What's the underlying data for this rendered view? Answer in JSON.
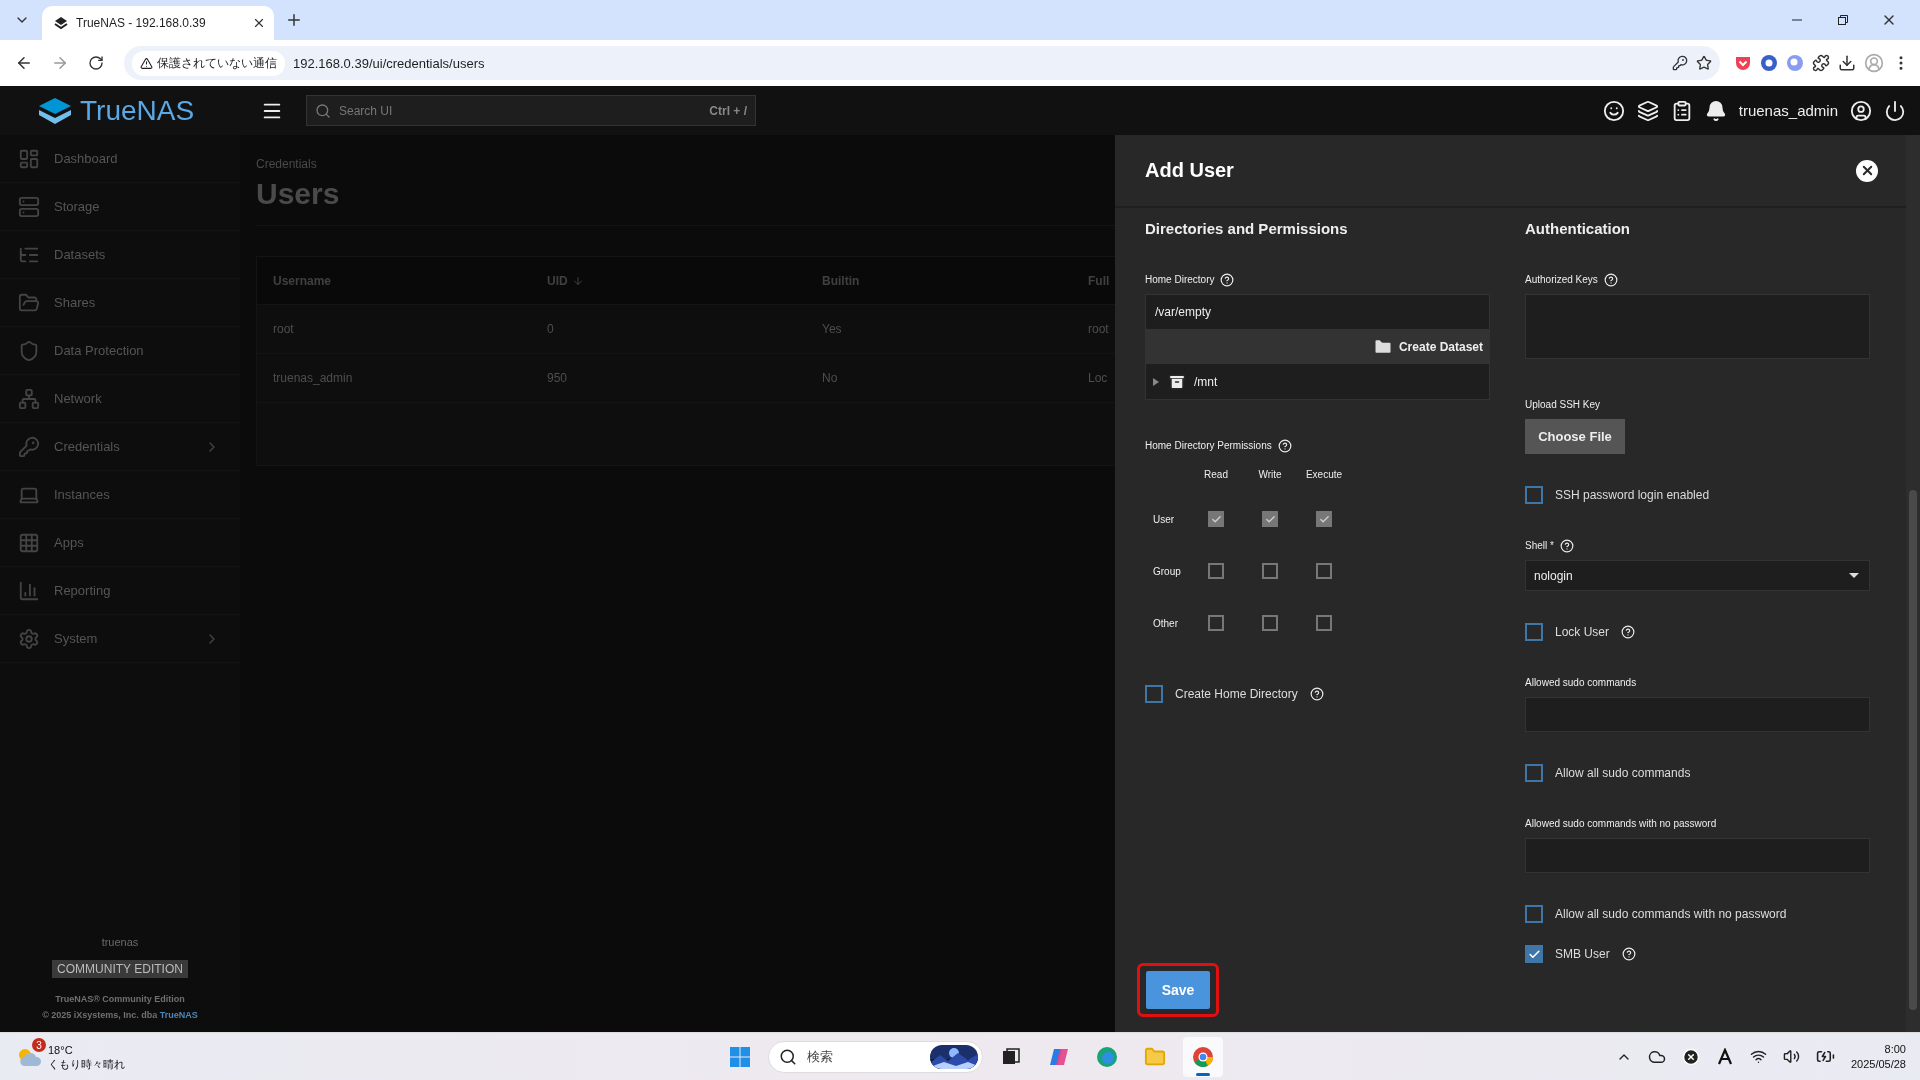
{
  "browser": {
    "tab": {
      "title": "TrueNAS - 192.168.0.39"
    },
    "security_chip": "保護されていない通信",
    "url": "192.168.0.39/ui/credentials/users"
  },
  "header": {
    "logo": "TrueNAS",
    "search": {
      "placeholder": "Search UI",
      "shortcut": "Ctrl + /"
    },
    "username": "truenas_admin"
  },
  "sidebar": {
    "items": [
      {
        "label": "Dashboard",
        "has_submenu": false
      },
      {
        "label": "Storage",
        "has_submenu": false
      },
      {
        "label": "Datasets",
        "has_submenu": false
      },
      {
        "label": "Shares",
        "has_submenu": false
      },
      {
        "label": "Data Protection",
        "has_submenu": false
      },
      {
        "label": "Network",
        "has_submenu": false
      },
      {
        "label": "Credentials",
        "has_submenu": true
      },
      {
        "label": "Instances",
        "has_submenu": false
      },
      {
        "label": "Apps",
        "has_submenu": false
      },
      {
        "label": "Reporting",
        "has_submenu": false
      },
      {
        "label": "System",
        "has_submenu": true
      }
    ],
    "footer": {
      "hostname": "truenas",
      "edition": "COMMUNITY EDITION",
      "product": "TrueNAS® Community Edition",
      "copyright": "© 2025 iXsystems, Inc. dba",
      "link": "TrueNAS"
    }
  },
  "page": {
    "breadcrumb": "Credentials",
    "title": "Users",
    "table": {
      "columns": [
        {
          "label": "Username",
          "sorted": false
        },
        {
          "label": "UID",
          "sorted": true
        },
        {
          "label": "Builtin",
          "sorted": false
        },
        {
          "label": "Full"
        }
      ],
      "rows": [
        {
          "cells": [
            "root",
            "0",
            "Yes",
            "root"
          ]
        },
        {
          "cells": [
            "truenas_admin",
            "950",
            "No",
            "Loc"
          ]
        }
      ]
    }
  },
  "panel": {
    "title": "Add User",
    "left": {
      "heading": "Directories and Permissions",
      "home_directory": {
        "label": "Home Directory",
        "help": true,
        "value": "/var/empty",
        "create_button": "Create Dataset",
        "tree": [
          {
            "label": "/mnt",
            "expanded": false
          }
        ]
      },
      "permissions": {
        "label": "Home Directory Permissions",
        "help": true,
        "columns": [
          "Read",
          "Write",
          "Execute"
        ],
        "rows": [
          {
            "label": "User",
            "cells": [
              {
                "checked": true
              },
              {
                "checked": true
              },
              {
                "checked": true
              }
            ]
          },
          {
            "label": "Group",
            "cells": [
              {
                "checked": false
              },
              {
                "checked": false
              },
              {
                "checked": false
              }
            ]
          },
          {
            "label": "Other",
            "cells": [
              {
                "checked": false
              },
              {
                "checked": false
              },
              {
                "checked": false
              }
            ]
          }
        ]
      },
      "create_home": {
        "label": "Create Home Directory",
        "checked": false,
        "help": true
      }
    },
    "right": {
      "heading": "Authentication",
      "fields": [
        {
          "kind": "textarea",
          "label": "Authorized Keys",
          "help": true
        },
        {
          "kind": "file",
          "label": "Upload SSH Key",
          "button": "Choose File"
        },
        {
          "kind": "checkbox",
          "label": "SSH password login enabled",
          "checked": false
        },
        {
          "kind": "select",
          "label": "Shell *",
          "help": true,
          "value": "nologin"
        },
        {
          "kind": "checkbox",
          "label": "Lock User",
          "checked": false,
          "help": true
        },
        {
          "kind": "input",
          "label": "Allowed sudo commands"
        },
        {
          "kind": "checkbox",
          "label": "Allow all sudo commands",
          "checked": false
        },
        {
          "kind": "input",
          "label": "Allowed sudo commands with no password"
        },
        {
          "kind": "checkbox",
          "label": "Allow all sudo commands with no password",
          "checked": false
        },
        {
          "kind": "checkbox",
          "label": "SMB User",
          "checked": true,
          "help": true
        }
      ]
    },
    "save": {
      "label": "Save",
      "highlighted": true
    }
  },
  "taskbar": {
    "weather": {
      "badge": "3",
      "temperature": "18°C",
      "condition": "くもり時々晴れ"
    },
    "search": {
      "placeholder": "検索"
    },
    "apps": [
      {
        "selected": false
      },
      {
        "selected": false
      },
      {
        "selected": false
      },
      {
        "selected": false
      },
      {
        "selected": true
      }
    ],
    "clock": {
      "time": "8:00",
      "date": "2025/05/28"
    }
  }
}
